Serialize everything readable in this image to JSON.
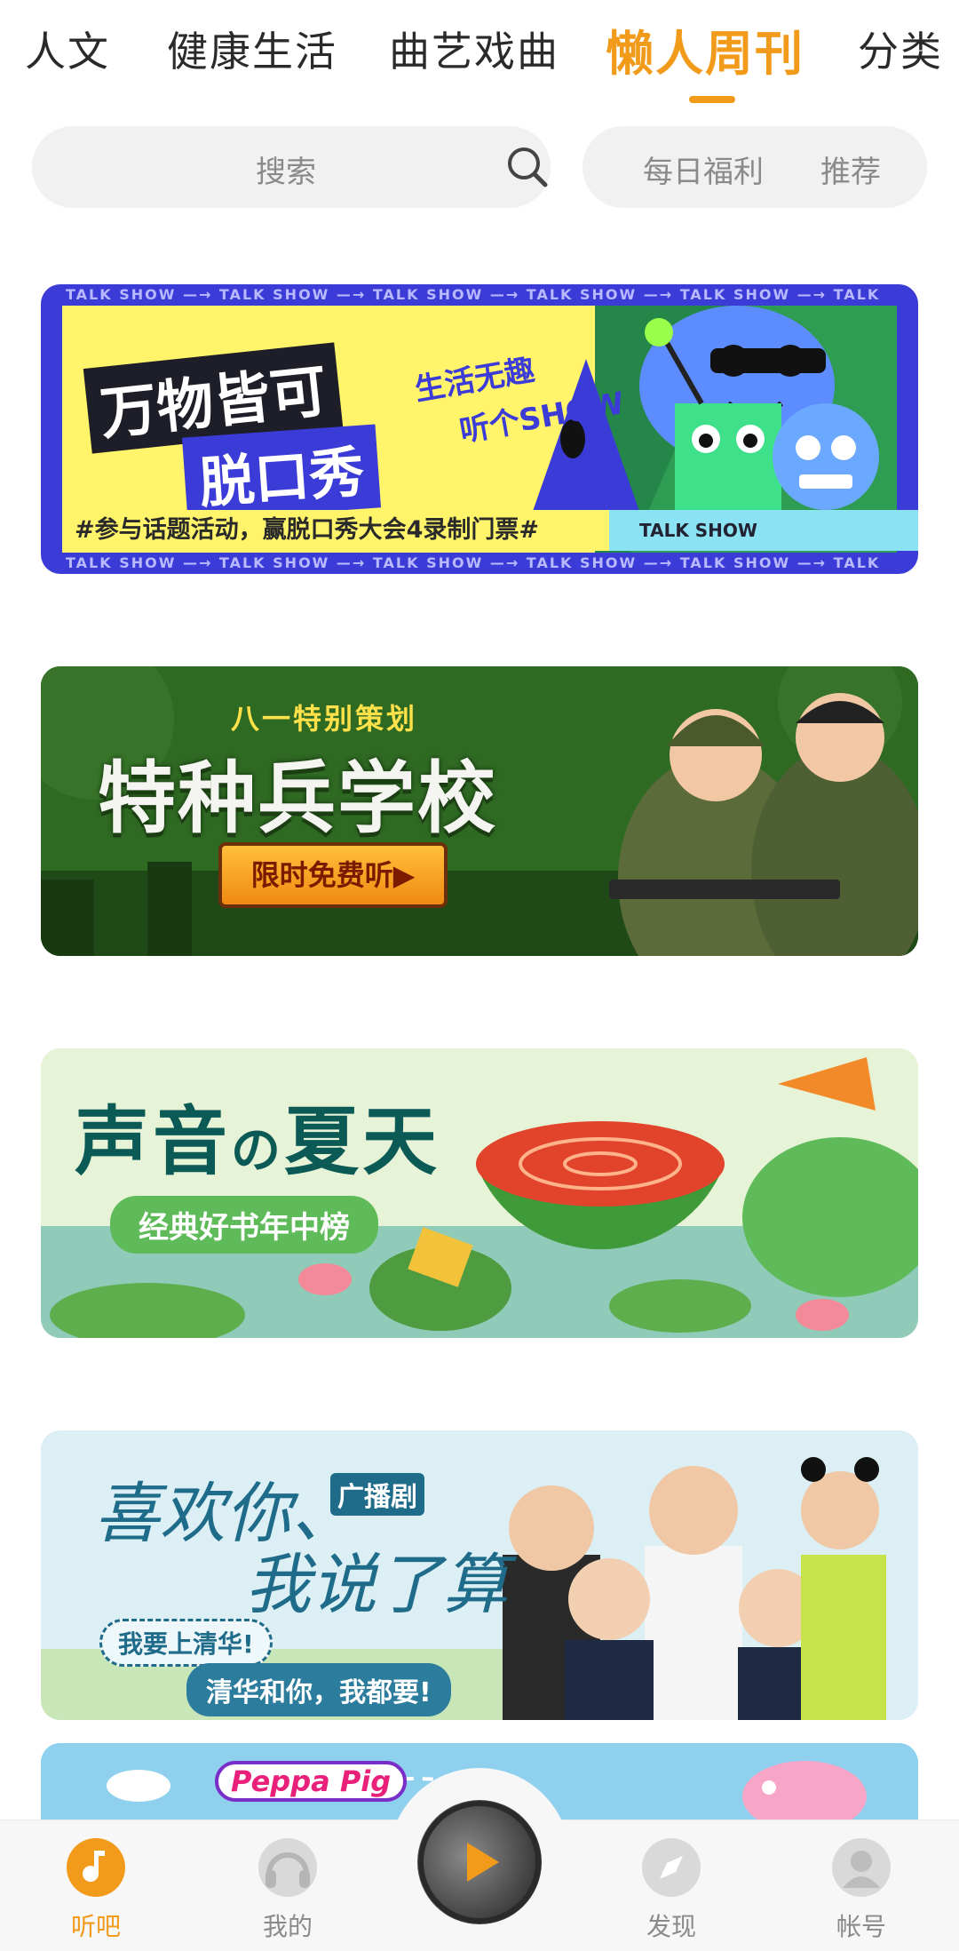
{
  "tabs": [
    {
      "label": "人文",
      "active": false
    },
    {
      "label": "健康生活",
      "active": false
    },
    {
      "label": "曲艺戏曲",
      "active": false
    },
    {
      "label": "懒人周刊",
      "active": true
    },
    {
      "label": "分类",
      "active": false
    }
  ],
  "search": {
    "placeholder": "搜索"
  },
  "promo": {
    "welfare": "每日福利",
    "recommend": "推荐"
  },
  "banners": {
    "talk_show": {
      "strip": "TALK SHOW —→ TALK SHOW —→ TALK SHOW —→ TALK SHOW —→ TALK SHOW —→ TALK SHOW",
      "title_line1": "万物皆可",
      "title_line2": "脱口秀",
      "sub_line1": "生活无趣",
      "sub_line2": "听个SHOW",
      "bottom": "#参与话题活动，赢脱口秀大会4录制门票#",
      "talk_label": "TALK SHOW"
    },
    "special_forces": {
      "kicker": "八一特别策划",
      "title": "特种兵学校",
      "button": "限时免费听▶"
    },
    "summer": {
      "title_a": "声音",
      "title_no": "の",
      "title_b": "夏天",
      "subtitle": "经典好书年中榜"
    },
    "radio_drama": {
      "title_line1": "喜欢你、",
      "title_line2": "我说了算",
      "tag": "广播剧",
      "quote1": "我要上清华!",
      "quote2": "清华和你，我都要!"
    },
    "peppa": {
      "logo": "Peppa Pig"
    }
  },
  "bottom_nav": [
    {
      "label": "听吧",
      "icon": "music-note-icon",
      "active": true
    },
    {
      "label": "我的",
      "icon": "headphones-icon",
      "active": false
    },
    {
      "label": "发现",
      "icon": "compass-icon",
      "active": false
    },
    {
      "label": "帐号",
      "icon": "user-icon",
      "active": false
    }
  ],
  "player": {
    "icon": "play-icon"
  },
  "colors": {
    "accent": "#f29a1a",
    "muted": "#8a8a8a",
    "pill_bg": "#f1f1f1"
  }
}
